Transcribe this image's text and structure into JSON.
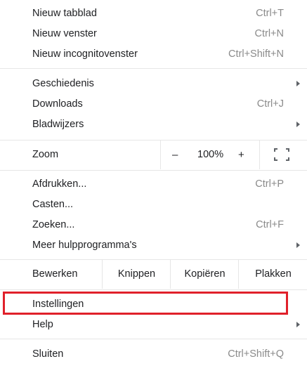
{
  "menu": {
    "new_tab": {
      "label": "Nieuw tabblad",
      "shortcut": "Ctrl+T"
    },
    "new_window": {
      "label": "Nieuw venster",
      "shortcut": "Ctrl+N"
    },
    "new_incognito": {
      "label": "Nieuw incognitovenster",
      "shortcut": "Ctrl+Shift+N"
    },
    "history": {
      "label": "Geschiedenis"
    },
    "downloads": {
      "label": "Downloads",
      "shortcut": "Ctrl+J"
    },
    "bookmarks": {
      "label": "Bladwijzers"
    },
    "zoom": {
      "label": "Zoom",
      "minus": "–",
      "value": "100%",
      "plus": "+"
    },
    "print": {
      "label": "Afdrukken...",
      "shortcut": "Ctrl+P"
    },
    "cast": {
      "label": "Casten..."
    },
    "find": {
      "label": "Zoeken...",
      "shortcut": "Ctrl+F"
    },
    "more_tools": {
      "label": "Meer hulpprogramma's"
    },
    "edit": {
      "label": "Bewerken",
      "cut": "Knippen",
      "copy": "Kopiëren",
      "paste": "Plakken"
    },
    "settings": {
      "label": "Instellingen"
    },
    "help": {
      "label": "Help"
    },
    "exit": {
      "label": "Sluiten",
      "shortcut": "Ctrl+Shift+Q"
    }
  },
  "colors": {
    "highlight_border": "#e0202a",
    "separator": "#e6e6e6",
    "shortcut_text": "#8a8a8a"
  },
  "icons": {
    "submenu": "chevron-right-icon",
    "fullscreen": "fullscreen-icon"
  }
}
